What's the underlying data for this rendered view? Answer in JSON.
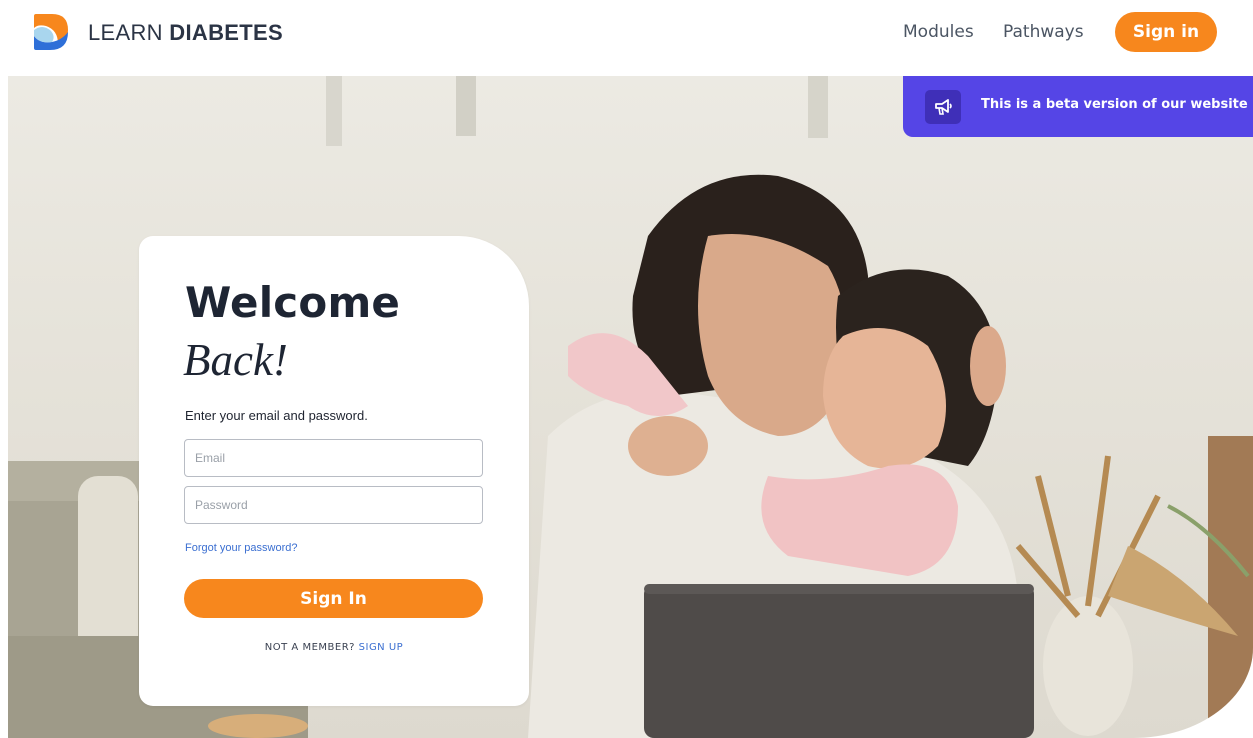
{
  "brand": {
    "name_light": "LEARN",
    "name_bold": "DIABETES",
    "logo_icon": "learn-diabetes-logo",
    "colors": {
      "orange": "#f7871d",
      "blue": "#2e6fd8",
      "light_blue": "#a9d6ee"
    }
  },
  "nav": {
    "modules": "Modules",
    "pathways": "Pathways",
    "signin": "Sign in"
  },
  "beta": {
    "icon": "megaphone-icon",
    "text": "This is a beta version of our website",
    "color": "#5545e6"
  },
  "login": {
    "title": "Welcome",
    "title_script": "Back!",
    "instructions": "Enter your email and password.",
    "email_placeholder": "Email",
    "password_placeholder": "Password",
    "forgot": "Forgot your password?",
    "submit": "Sign In",
    "not_member": "NOT A MEMBER?",
    "sign_up": "SIGN UP"
  },
  "accent": "#f7871d"
}
